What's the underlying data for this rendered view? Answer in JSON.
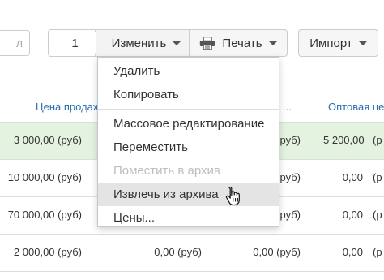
{
  "toolbar": {
    "search_placeholder": "л",
    "counter_value": "1",
    "edit_label": "Изменить",
    "print_label": "Печать",
    "import_label": "Импорт"
  },
  "table": {
    "columns": [
      "Цена продаж",
      "...",
      "Оптовая це"
    ],
    "rows": [
      {
        "price": "3 000,00",
        "c2": "",
        "c3": "(руб)",
        "wholesale": "5 200,00",
        "c5": "(р",
        "selected": true
      },
      {
        "price": "10 000,00",
        "c2": "",
        "c3": "(руб)",
        "wholesale": "0,00",
        "c5": "(р",
        "selected": false
      },
      {
        "price": "70 000,00",
        "c2": "",
        "c3": "(руб)",
        "wholesale": "0,00",
        "c5": "(р",
        "selected": false
      },
      {
        "price": "2 000,00",
        "c2": "0,00 (руб)",
        "c3": "0,00 (руб)",
        "wholesale": "0,00",
        "c5": "(р",
        "selected": false
      }
    ],
    "price_suffix": "(руб)",
    "wholesale_suffix": "(руб)"
  },
  "menu": {
    "items": [
      {
        "label": "Удалить",
        "state": "normal"
      },
      {
        "label": "Копировать",
        "state": "normal"
      },
      {
        "label": "Массовое редактирование",
        "state": "normal"
      },
      {
        "label": "Переместить",
        "state": "normal"
      },
      {
        "label": "Поместить в архив",
        "state": "disabled"
      },
      {
        "label": "Извлечь из архива",
        "state": "hover"
      },
      {
        "label": "Цены...",
        "state": "normal"
      }
    ]
  },
  "colors": {
    "link": "#2a6fb5",
    "selected_row": "#e3f3e0",
    "hover_item": "#e4e4e4",
    "disabled_text": "#bdbdbd"
  },
  "icons": [
    "print-icon",
    "caret-down-icon",
    "hand-pointer-icon"
  ]
}
